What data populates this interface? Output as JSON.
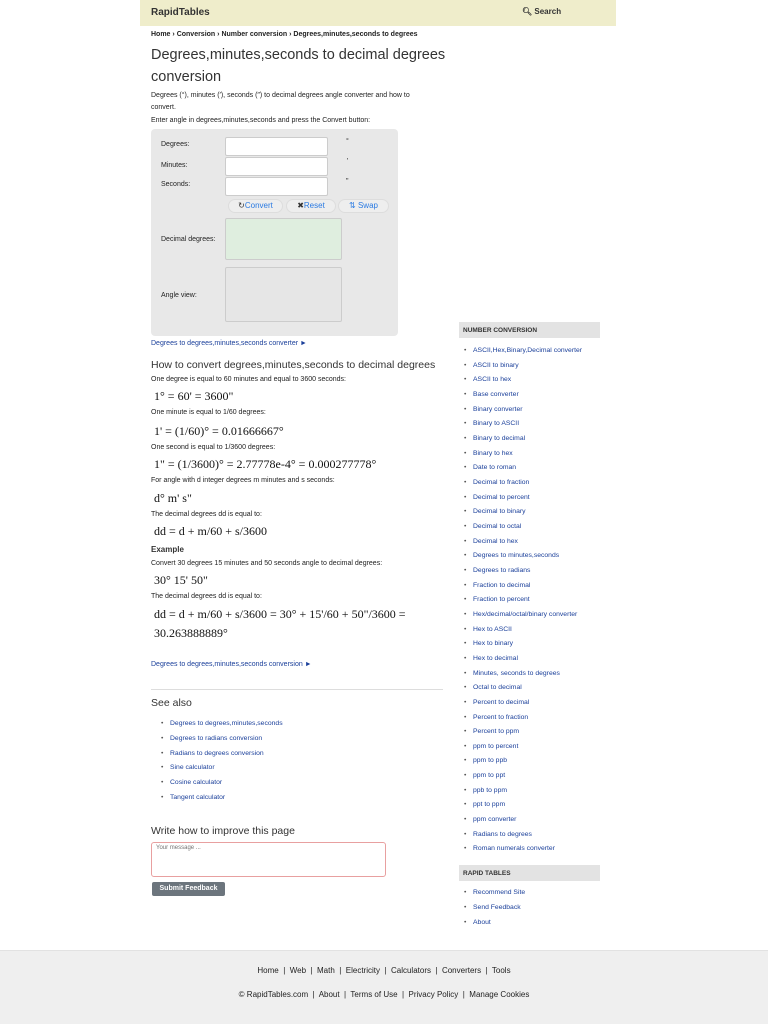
{
  "header": {
    "logo": "RapidTables",
    "search": "Search"
  },
  "breadcrumb": [
    "Home",
    "Conversion",
    "Number conversion",
    "Degrees,minutes,seconds to degrees"
  ],
  "title": {
    "line1": "Degrees,minutes,seconds to decimal degrees",
    "line2": "conversion"
  },
  "intro": {
    "line1": "Degrees (°), minutes (′), seconds (″) to decimal degrees angle converter and how to",
    "line2": "convert.",
    "enter": "Enter angle in degrees,minutes,seconds and press the Convert button:"
  },
  "form": {
    "degrees_label": "Degrees:",
    "minutes_label": "Minutes:",
    "seconds_label": "Seconds:",
    "deg_sym": "°",
    "min_sym": "'",
    "sec_sym": "\"",
    "degrees_value": "",
    "minutes_value": "",
    "seconds_value": "",
    "convert": "Convert",
    "reset": "Reset",
    "swap": "Swap",
    "decimal_label": "Decimal degrees:",
    "angle_label": "Angle view:"
  },
  "link1": "Degrees to degrees,minutes,seconds converter ►",
  "howto": {
    "title": "How to convert degrees,minutes,seconds to decimal degrees",
    "t1": "One degree is equal to 60 minutes and equal to 3600 seconds:",
    "f1": "1° = 60' = 3600\"",
    "t2": "One minute is equal to 1/60 degrees:",
    "f2": "1' = (1/60)° = 0.01666667°",
    "t3": "One second is equal to 1/3600 degrees:",
    "f3": "1\" = (1/3600)° = 2.77778e-4° = 0.000277778°",
    "t4": "For angle with d integer degrees m minutes and s seconds:",
    "f4": "d° m' s\"",
    "t5": "The decimal degrees dd is equal to:",
    "f5": "dd = d + m/60 + s/3600",
    "example": "Example",
    "t6": "Convert 30 degrees 15 minutes and 50 seconds angle to decimal degrees:",
    "f6": "30° 15' 50\"",
    "t7": "The decimal degrees dd is equal to:",
    "f7a": "dd = d + m/60 + s/3600 = 30° + 15'/60 + 50\"/3600 =",
    "f7b": "30.263888889°"
  },
  "link2": "Degrees to degrees,minutes,seconds conversion ►",
  "see_also": {
    "title": "See also",
    "items": [
      "Degrees to degrees,minutes,seconds",
      "Degrees to radians conversion",
      "Radians to degrees conversion",
      "Sine calculator",
      "Cosine calculator",
      "Tangent calculator"
    ]
  },
  "feedback": {
    "title": "Write how to improve this page",
    "placeholder": "Your message ...",
    "submit": "Submit Feedback"
  },
  "sidebar": {
    "number_title": "NUMBER CONVERSION",
    "number_items": [
      "ASCII,Hex,Binary,Decimal converter",
      "ASCII to binary",
      "ASCII to hex",
      "Base converter",
      "Binary converter",
      "Binary to ASCII",
      "Binary to decimal",
      "Binary to hex",
      "Date to roman",
      "Decimal to fraction",
      "Decimal to percent",
      "Decimal to binary",
      "Decimal to octal",
      "Decimal to hex",
      "Degrees to minutes,seconds",
      "Degrees to radians",
      "Fraction to decimal",
      "Fraction to percent",
      "Hex/decimal/octal/binary converter",
      "Hex to ASCII",
      "Hex to binary",
      "Hex to decimal",
      "Minutes, seconds to degrees",
      "Octal to decimal",
      "Percent to decimal",
      "Percent to fraction",
      "Percent to ppm",
      "ppm to percent",
      "ppm to ppb",
      "ppm to ppt",
      "ppb to ppm",
      "ppt to ppm",
      "ppm converter",
      "Radians to degrees",
      "Roman numerals converter"
    ],
    "rapid_title": "RAPID TABLES",
    "rapid_items": [
      "Recommend Site",
      "Send Feedback",
      "About"
    ]
  },
  "footer": {
    "row1": [
      "Home",
      "Web",
      "Math",
      "Electricity",
      "Calculators",
      "Converters",
      "Tools"
    ],
    "row2": [
      "© RapidTables.com",
      "About",
      "Terms of Use",
      "Privacy Policy",
      "Manage Cookies"
    ]
  }
}
